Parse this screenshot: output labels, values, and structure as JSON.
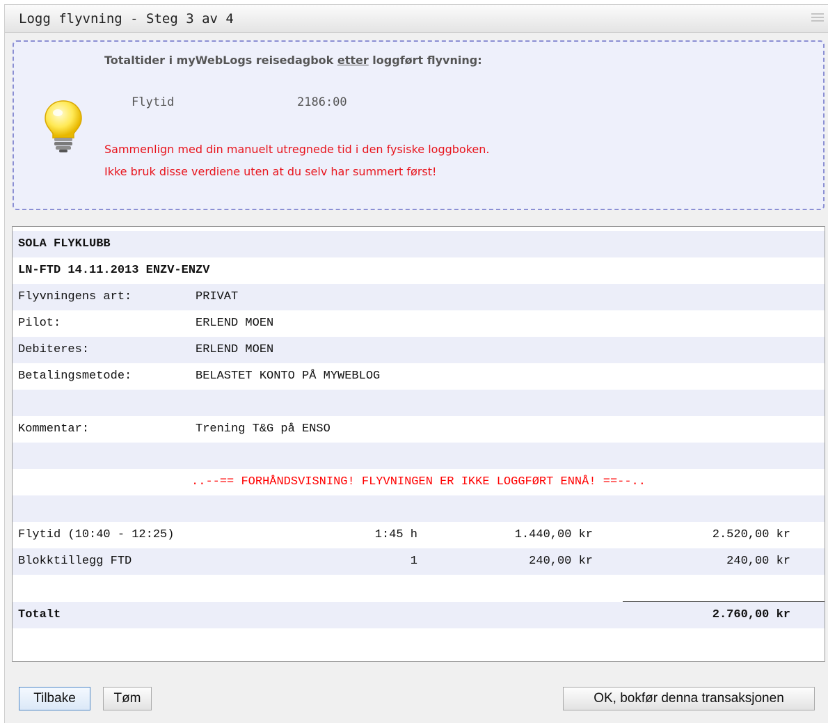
{
  "window": {
    "title": "Logg flyvning - Steg 3 av 4"
  },
  "info": {
    "heading_before": "Totaltider i myWebLogs reisedagbok ",
    "heading_underlined": "etter",
    "heading_after": " loggført flyvning:",
    "flytid_label": "Flytid",
    "flytid_value": "2186:00",
    "warning_line1": "Sammenlign med din manuelt utregnede tid i den fysiske loggboken.",
    "warning_line2": "Ikke bruk disse verdiene uten at du selv har summert først!"
  },
  "receipt": {
    "club": "SOLA FLYKLUBB",
    "flight": "LN-FTD 14.11.2013 ENZV-ENZV",
    "fields": [
      {
        "label": "Flyvningens art:",
        "value": "PRIVAT"
      },
      {
        "label": "Pilot:",
        "value": "ERLEND MOEN"
      },
      {
        "label": "Debiteres:",
        "value": "ERLEND MOEN"
      },
      {
        "label": "Betalingsmetode:",
        "value": "BELASTET KONTO PÅ MYWEBLOG"
      }
    ],
    "comment": {
      "label": "Kommentar:",
      "value": "Trening T&G på ENSO"
    },
    "preview_notice": "..--== FORHÅNDSVISNING! FLYVNINGEN ER IKKE LOGGFØRT ENNÅ! ==--..",
    "lines": [
      {
        "desc": "Flytid (10:40 - 12:25)",
        "qty": "1:45 h",
        "unit_price": "1.440,00 kr",
        "amount": "2.520,00 kr"
      },
      {
        "desc": "Blokktillegg FTD",
        "qty": "1",
        "unit_price": "240,00 kr",
        "amount": "240,00 kr"
      }
    ],
    "total": {
      "label": "Totalt",
      "amount": "2.760,00",
      "currency": "kr"
    }
  },
  "buttons": {
    "back": "Tilbake",
    "clear": "Tøm",
    "confirm": "OK, bokfør denna transaksjonen"
  },
  "colors": {
    "warning": "#e8141c",
    "preview": "#ff0000",
    "stripe": "#eceef9",
    "infobox_border": "#8b8fd4"
  }
}
